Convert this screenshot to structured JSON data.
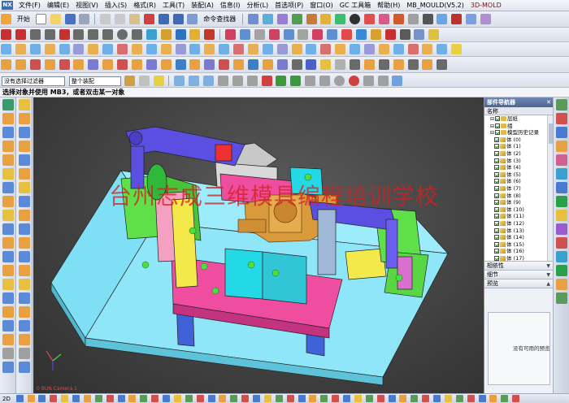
{
  "menubar": {
    "items": [
      "文件(F)",
      "编辑(E)",
      "视图(V)",
      "插入(S)",
      "格式(R)",
      "工具(T)",
      "装配(A)",
      "信息(I)",
      "分析(L)",
      "首选项(P)",
      "窗口(O)",
      "GC 工具箱",
      "帮助(H)",
      "MB_MOULD(V5.2)",
      "3D-MOLD"
    ]
  },
  "toolbar": {
    "start_label": "开始",
    "command_finder_label": "命令查找器",
    "filter_value": "没有选择过滤器",
    "assembly_value": "整个装配"
  },
  "cue_line": "选择对象并使用 MB3，或者双击某一对象",
  "viewport": {
    "watermark": "台州志成三维模具编程培训学校",
    "camera_label": "0 BUN Camera 1"
  },
  "navigator": {
    "title": "部件导航器",
    "column_header": "名称",
    "tree": [
      {
        "label": "层纸",
        "kind": "check",
        "indent": 1
      },
      {
        "label": "组",
        "kind": "folder",
        "indent": 1
      },
      {
        "label": "模型历史记录",
        "kind": "folder",
        "indent": 1
      },
      {
        "label": "体 (0)",
        "kind": "body",
        "indent": 2
      },
      {
        "label": "体 (1)",
        "kind": "body",
        "indent": 2
      },
      {
        "label": "体 (2)",
        "kind": "body",
        "indent": 2
      },
      {
        "label": "体 (3)",
        "kind": "body",
        "indent": 2
      },
      {
        "label": "体 (4)",
        "kind": "body",
        "indent": 2
      },
      {
        "label": "体 (5)",
        "kind": "body",
        "indent": 2
      },
      {
        "label": "体 (6)",
        "kind": "body",
        "indent": 2
      },
      {
        "label": "体 (7)",
        "kind": "body",
        "indent": 2
      },
      {
        "label": "体 (8)",
        "kind": "body",
        "indent": 2
      },
      {
        "label": "体 (9)",
        "kind": "body",
        "indent": 2
      },
      {
        "label": "体 (10)",
        "kind": "body",
        "indent": 2
      },
      {
        "label": "体 (11)",
        "kind": "body",
        "indent": 2
      },
      {
        "label": "体 (12)",
        "kind": "body",
        "indent": 2
      },
      {
        "label": "体 (13)",
        "kind": "body",
        "indent": 2
      },
      {
        "label": "体 (14)",
        "kind": "body",
        "indent": 2
      },
      {
        "label": "体 (15)",
        "kind": "body",
        "indent": 2
      },
      {
        "label": "体 (16)",
        "kind": "body",
        "indent": 2
      },
      {
        "label": "体 (17)",
        "kind": "body",
        "indent": 2
      }
    ],
    "sections": {
      "dependencies": "相依性",
      "details": "细节",
      "preview": "预览"
    },
    "preview_empty": "没有可用的预览"
  },
  "colors": {
    "base_plate": "#7fe0f5",
    "arm_blue": "#5a4fe0",
    "pink": "#ef4ea0",
    "cyan": "#23d9e6",
    "green": "#5fdf4a",
    "yellow": "#f3e94a",
    "part_gold": "#d99a3c",
    "blue_feet": "#4062d8"
  }
}
